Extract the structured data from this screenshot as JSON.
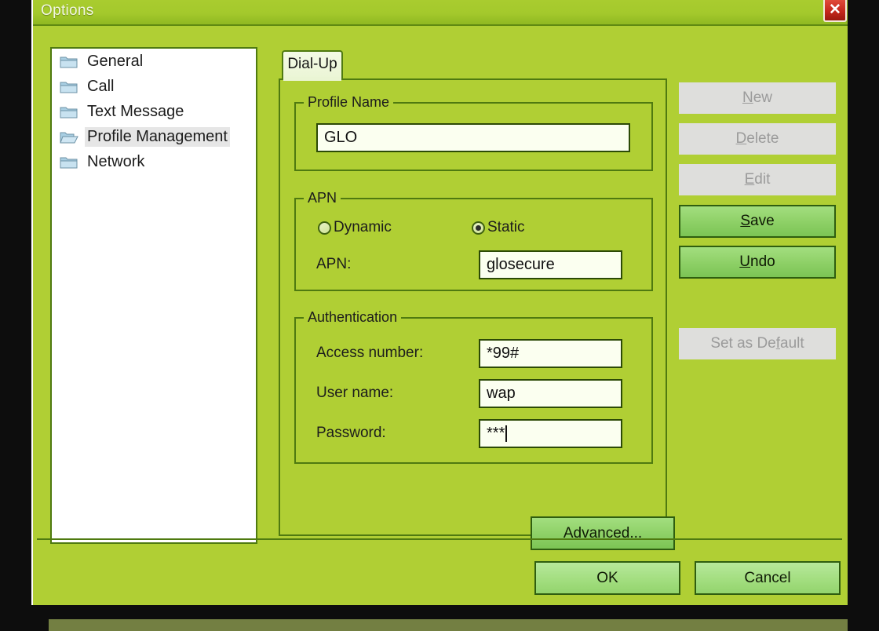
{
  "window": {
    "title": "Options",
    "close_icon": "close-icon",
    "close_glyph": "✕"
  },
  "colors": {
    "window_background": "#b0cf34",
    "titlebar": "#a4c92c",
    "border": "#4f7a10",
    "field_background": "#fbfff0",
    "button_enabled": "#8fd168",
    "button_disabled_bg": "#dededc",
    "button_disabled_text": "#9b9b9b",
    "close_button": "#c5281c",
    "selection_highlight": "#e6e6e6"
  },
  "sidebar": {
    "items": [
      {
        "label": "General",
        "icon": "folder-closed-icon",
        "selected": false
      },
      {
        "label": "Call",
        "icon": "folder-closed-icon",
        "selected": false
      },
      {
        "label": "Text Message",
        "icon": "folder-closed-icon",
        "selected": false
      },
      {
        "label": "Profile Management",
        "icon": "folder-open-icon",
        "selected": true
      },
      {
        "label": "Network",
        "icon": "folder-closed-icon",
        "selected": false
      }
    ]
  },
  "tabs": [
    {
      "label": "Dial-Up",
      "active": true
    }
  ],
  "profile_name_group": {
    "title": "Profile Name",
    "input": {
      "value": "GLO",
      "placeholder": ""
    }
  },
  "apn_group": {
    "title": "APN",
    "radios": [
      {
        "label": "Dynamic",
        "checked": false
      },
      {
        "label": "Static",
        "checked": true
      }
    ],
    "apn_label": "APN:",
    "apn_input": {
      "value": "glosecure",
      "placeholder": ""
    }
  },
  "authentication_group": {
    "title": "Authentication",
    "access_number_label": "Access number:",
    "access_number_input": {
      "value": "*99#",
      "placeholder": ""
    },
    "user_name_label": "User name:",
    "user_name_input": {
      "value": "wap",
      "placeholder": ""
    },
    "password_label": "Password:",
    "password_input": {
      "value": "***",
      "placeholder": "",
      "focused": true
    }
  },
  "advanced_button": {
    "label": "Advanced...",
    "accesskey": "A",
    "enabled": true
  },
  "side_buttons": [
    {
      "label": "New",
      "accesskey": "N",
      "enabled": false
    },
    {
      "label": "Delete",
      "accesskey": "D",
      "enabled": false
    },
    {
      "label": "Edit",
      "accesskey": "E",
      "enabled": false
    },
    {
      "label": "Save",
      "accesskey": "S",
      "enabled": true
    },
    {
      "label": "Undo",
      "accesskey": "U",
      "enabled": true
    }
  ],
  "set_default_button": {
    "label": "Set as Default",
    "accesskey": "f",
    "enabled": false
  },
  "footer_buttons": [
    {
      "label": "OK",
      "enabled": true
    },
    {
      "label": "Cancel",
      "enabled": true
    }
  ]
}
